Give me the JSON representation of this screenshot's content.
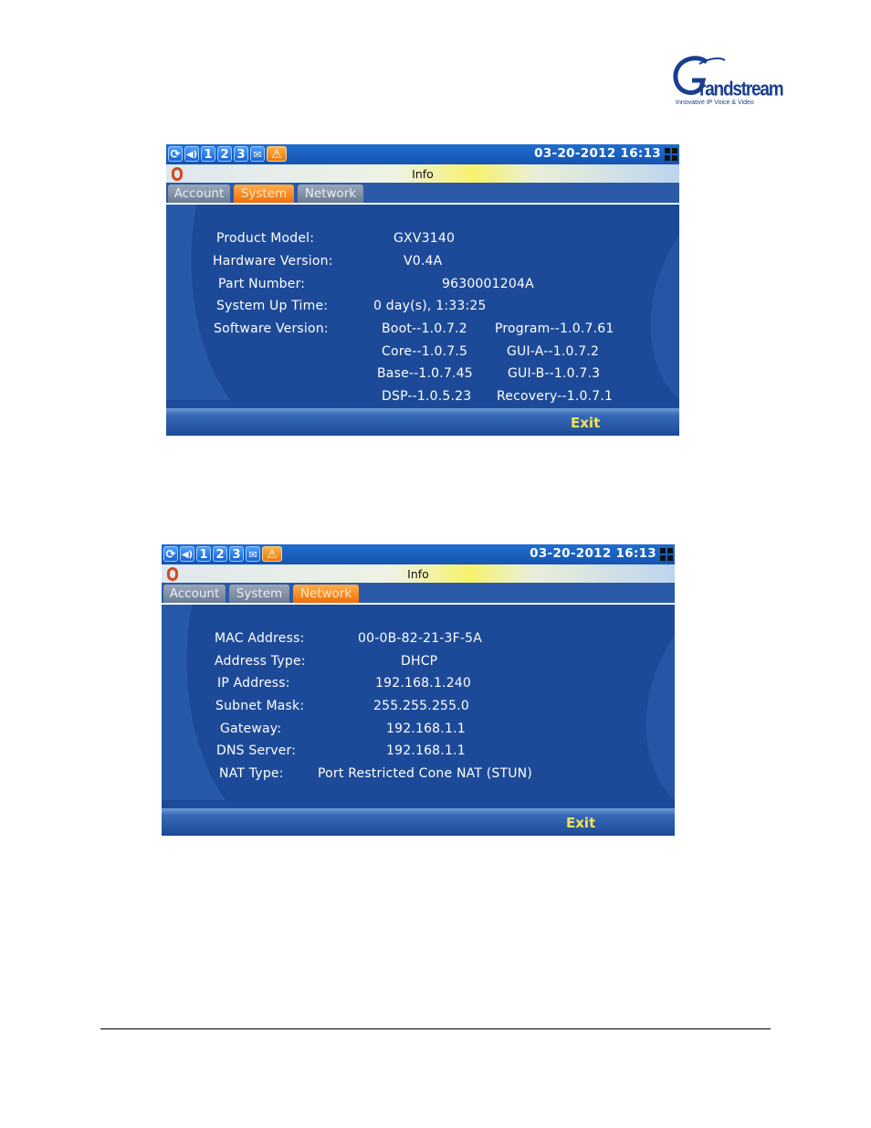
{
  "logo": {
    "brand": "Grandstream",
    "word": "randstream",
    "tagline": "Innovative IP Voice & Video"
  },
  "screens": [
    {
      "status": {
        "icons": [
          "sync-icon",
          "volume-icon"
        ],
        "lines": [
          "1",
          "2",
          "3"
        ],
        "datetime": "03-20-2012 16:13"
      },
      "title": "Info",
      "tabs": [
        "Account",
        "System",
        "Network"
      ],
      "active_tab": "System",
      "rows": [
        {
          "label": "Product Model:",
          "value": "GXV3140"
        },
        {
          "label": "Hardware Version:",
          "value": "V0.4A"
        },
        {
          "label": "Part Number:",
          "value": "9630001204A"
        },
        {
          "label": "System Up Time:",
          "value": "0 day(s), 1:33:25"
        },
        {
          "label": "Software Version:",
          "value": "Boot--1.0.7.2",
          "value2": "Program--1.0.7.61"
        },
        {
          "label": "",
          "value": "Core--1.0.7.5",
          "value2": "GUI-A--1.0.7.2"
        },
        {
          "label": "",
          "value": "Base--1.0.7.45",
          "value2": "GUI-B--1.0.7.3"
        },
        {
          "label": "",
          "value": "DSP--1.0.5.23",
          "value2": "Recovery--1.0.7.1"
        }
      ],
      "exit_label": "Exit"
    },
    {
      "status": {
        "icons": [
          "sync-icon",
          "volume-icon"
        ],
        "lines": [
          "1",
          "2",
          "3"
        ],
        "datetime": "03-20-2012 16:13"
      },
      "title": "Info",
      "tabs": [
        "Account",
        "System",
        "Network"
      ],
      "active_tab": "Network",
      "rows": [
        {
          "label": "MAC Address:",
          "value": "00-0B-82-21-3F-5A"
        },
        {
          "label": "Address Type:",
          "value": "DHCP"
        },
        {
          "label": "IP Address:",
          "value": "192.168.1.240"
        },
        {
          "label": "Subnet Mask:",
          "value": "255.255.255.0"
        },
        {
          "label": "Gateway:",
          "value": "192.168.1.1"
        },
        {
          "label": "DNS Server:",
          "value": "192.168.1.1"
        },
        {
          "label": "NAT Type:",
          "value": "Port Restricted Cone NAT (STUN)"
        }
      ],
      "exit_label": "Exit"
    }
  ]
}
